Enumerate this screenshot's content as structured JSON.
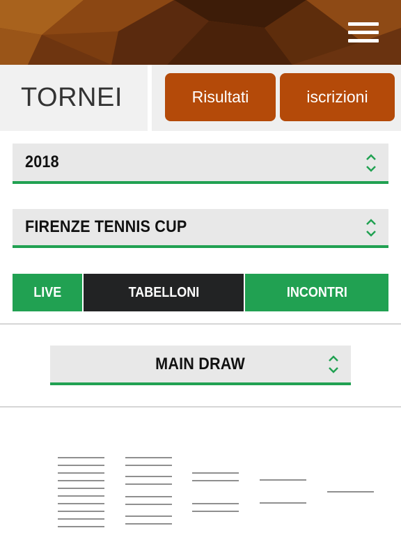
{
  "header": {
    "menu_icon": "hamburger-icon",
    "background_color": "#7a3c10"
  },
  "page": {
    "title": "TORNEI"
  },
  "actions": {
    "results_label": "Risultati",
    "signup_label": "iscrizioni",
    "button_color": "#b44a09"
  },
  "filters": {
    "year": "2018",
    "tournament": "FIRENZE TENNIS CUP",
    "draw": "MAIN DRAW",
    "select_icon": "updown-chevron-icon"
  },
  "tabs": [
    {
      "label": "LIVE",
      "active": false
    },
    {
      "label": "TABELLONI",
      "active": true
    },
    {
      "label": "INCONTRI",
      "active": false
    }
  ],
  "colors": {
    "accent_green": "#21a152",
    "active_tab": "#222324"
  }
}
